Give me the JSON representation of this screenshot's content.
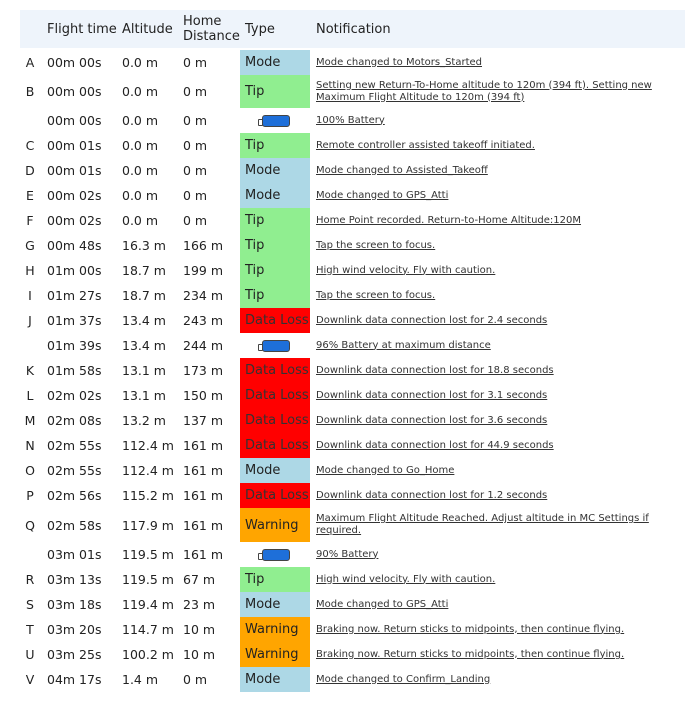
{
  "headers": {
    "flight_time": "Flight time",
    "altitude": "Altitude",
    "home_line1": "Home",
    "home_line2": "Distance",
    "type": "Type",
    "notification": "Notification"
  },
  "colors": {
    "Mode": "#add8e6",
    "Tip": "#90ee90",
    "Data Loss": "#ff0000",
    "Warning": "#ffa500"
  },
  "rows": [
    {
      "letter": "A",
      "time": "00m 00s",
      "alt": "0.0 m",
      "dist": "0 m",
      "type": "Mode",
      "note": "Mode changed to Motors_Started"
    },
    {
      "letter": "B",
      "time": "00m 00s",
      "alt": "0.0 m",
      "dist": "0 m",
      "type": "Tip",
      "note": "Setting new Return-To-Home altitude to 120m (394 ft). Setting new Maximum Flight Altitude to 120m (394 ft)"
    },
    {
      "letter": "",
      "time": "00m 00s",
      "alt": "0.0 m",
      "dist": "0 m",
      "type": "battery",
      "note": "100% Battery"
    },
    {
      "letter": "C",
      "time": "00m 01s",
      "alt": "0.0 m",
      "dist": "0 m",
      "type": "Tip",
      "note": "Remote controller assisted takeoff initiated."
    },
    {
      "letter": "D",
      "time": "00m 01s",
      "alt": "0.0 m",
      "dist": "0 m",
      "type": "Mode",
      "note": "Mode changed to Assisted_Takeoff"
    },
    {
      "letter": "E",
      "time": "00m 02s",
      "alt": "0.0 m",
      "dist": "0 m",
      "type": "Mode",
      "note": "Mode changed to GPS_Atti"
    },
    {
      "letter": "F",
      "time": "00m 02s",
      "alt": "0.0 m",
      "dist": "0 m",
      "type": "Tip",
      "note": "Home Point recorded. Return-to-Home Altitude:120M"
    },
    {
      "letter": "G",
      "time": "00m 48s",
      "alt": "16.3 m",
      "dist": "166 m",
      "type": "Tip",
      "note": "Tap the screen to focus."
    },
    {
      "letter": "H",
      "time": "01m 00s",
      "alt": "18.7 m",
      "dist": "199 m",
      "type": "Tip",
      "note": "High wind velocity. Fly with caution."
    },
    {
      "letter": "I",
      "time": "01m 27s",
      "alt": "18.7 m",
      "dist": "234 m",
      "type": "Tip",
      "note": "Tap the screen to focus."
    },
    {
      "letter": "J",
      "time": "01m 37s",
      "alt": "13.4 m",
      "dist": "243 m",
      "type": "Data Loss",
      "note": "Downlink data connection lost for 2.4 seconds"
    },
    {
      "letter": "",
      "time": "01m 39s",
      "alt": "13.4 m",
      "dist": "244 m",
      "type": "battery",
      "note": "96% Battery at maximum distance"
    },
    {
      "letter": "K",
      "time": "01m 58s",
      "alt": "13.1 m",
      "dist": "173 m",
      "type": "Data Loss",
      "note": "Downlink data connection lost for 18.8 seconds"
    },
    {
      "letter": "L",
      "time": "02m 02s",
      "alt": "13.1 m",
      "dist": "150 m",
      "type": "Data Loss",
      "note": "Downlink data connection lost for 3.1 seconds"
    },
    {
      "letter": "M",
      "time": "02m 08s",
      "alt": "13.2 m",
      "dist": "137 m",
      "type": "Data Loss",
      "note": "Downlink data connection lost for 3.6 seconds"
    },
    {
      "letter": "N",
      "time": "02m 55s",
      "alt": "112.4 m",
      "dist": "161 m",
      "type": "Data Loss",
      "note": "Downlink data connection lost for 44.9 seconds"
    },
    {
      "letter": "O",
      "time": "02m 55s",
      "alt": "112.4 m",
      "dist": "161 m",
      "type": "Mode",
      "note": "Mode changed to Go_Home"
    },
    {
      "letter": "P",
      "time": "02m 56s",
      "alt": "115.2 m",
      "dist": "161 m",
      "type": "Data Loss",
      "note": "Downlink data connection lost for 1.2 seconds"
    },
    {
      "letter": "Q",
      "time": "02m 58s",
      "alt": "117.9 m",
      "dist": "161 m",
      "type": "Warning",
      "note": "Maximum Flight Altitude Reached. Adjust altitude in MC Settings if required."
    },
    {
      "letter": "",
      "time": "03m 01s",
      "alt": "119.5 m",
      "dist": "161 m",
      "type": "battery",
      "note": "90% Battery"
    },
    {
      "letter": "R",
      "time": "03m 13s",
      "alt": "119.5 m",
      "dist": "67 m",
      "type": "Tip",
      "note": "High wind velocity. Fly with caution."
    },
    {
      "letter": "S",
      "time": "03m 18s",
      "alt": "119.4 m",
      "dist": "23 m",
      "type": "Mode",
      "note": "Mode changed to GPS_Atti"
    },
    {
      "letter": "T",
      "time": "03m 20s",
      "alt": "114.7 m",
      "dist": "10 m",
      "type": "Warning",
      "note": "Braking now. Return sticks to midpoints, then continue flying."
    },
    {
      "letter": "U",
      "time": "03m 25s",
      "alt": "100.2 m",
      "dist": "10 m",
      "type": "Warning",
      "note": "Braking now. Return sticks to midpoints, then continue flying."
    },
    {
      "letter": "V",
      "time": "04m 17s",
      "alt": "1.4 m",
      "dist": "0 m",
      "type": "Mode",
      "note": "Mode changed to Confirm_Landing"
    }
  ]
}
